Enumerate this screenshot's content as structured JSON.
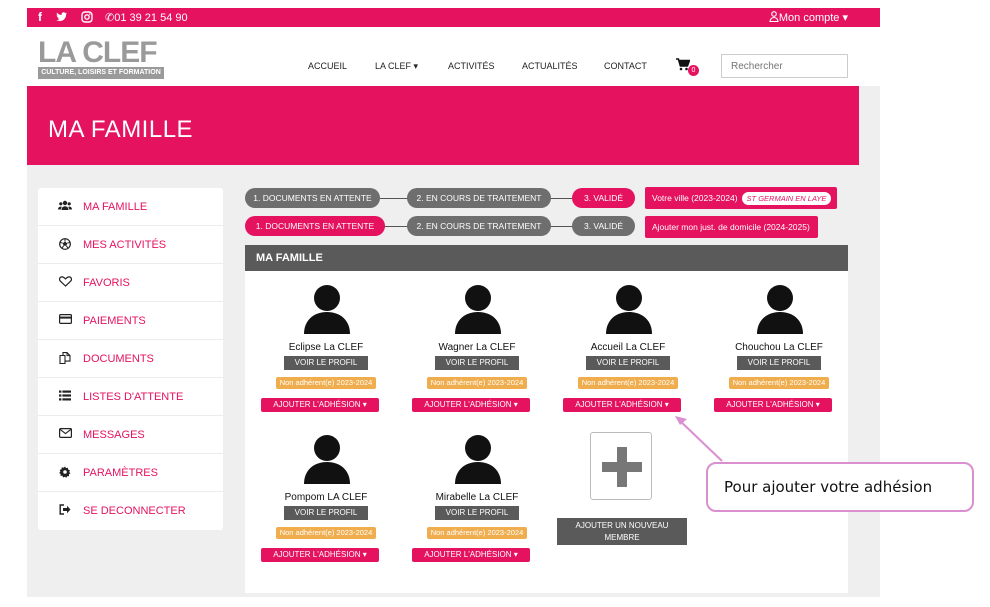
{
  "topbar": {
    "icons": [
      "facebook-icon",
      "twitter-icon",
      "instagram-icon",
      "phone-icon",
      "user-icon"
    ],
    "phone": "01 39 21 54 90",
    "account": "Mon compte ▾"
  },
  "logo": {
    "text": "LA CLEF",
    "tagline": "CULTURE, LOISIRS ET FORMATION"
  },
  "nav": {
    "items": [
      "ACCUEIL",
      "LA CLEF ▾",
      "ACTIVITÉS",
      "ACTUALITÉS",
      "CONTACT"
    ],
    "cart_count": "0",
    "search_placeholder": "Rechercher"
  },
  "banner": {
    "title": "MA FAMILLE"
  },
  "sidebar": {
    "items": [
      {
        "label": "MA FAMILLE",
        "icon": "users-icon"
      },
      {
        "label": "MES ACTIVITÉS",
        "icon": "soccer-ball-icon"
      },
      {
        "label": "FAVORIS",
        "icon": "heart-icon"
      },
      {
        "label": "PAIEMENTS",
        "icon": "credit-card-icon"
      },
      {
        "label": "DOCUMENTS",
        "icon": "documents-icon"
      },
      {
        "label": "LISTES D'ATTENTE",
        "icon": "list-icon"
      },
      {
        "label": "MESSAGES",
        "icon": "envelope-icon"
      },
      {
        "label": "PARAMÈTRES",
        "icon": "gear-icon"
      },
      {
        "label": "SE DECONNECTER",
        "icon": "sign-out-icon"
      }
    ]
  },
  "steps": {
    "labels": [
      "1. DOCUMENTS EN ATTENTE",
      "2. EN COURS DE TRAITEMENT",
      "3. VALIDÉ"
    ],
    "row1_status": "Votre ville (2023-2024)",
    "row1_city": "ST GERMAIN EN LAYE",
    "row2_status": "Ajouter mon just. de domicile (2024-2025)"
  },
  "panel": {
    "title": "MA FAMILLE"
  },
  "members": [
    {
      "name": "Eclipse La CLEF"
    },
    {
      "name": "Wagner La CLEF"
    },
    {
      "name": "Accueil La CLEF"
    },
    {
      "name": "Chouchou La CLEF"
    },
    {
      "name": "Pompom LA CLEF"
    },
    {
      "name": "Mirabelle La CLEF"
    }
  ],
  "member_labels": {
    "view_profile": "VOIR LE PROFIL",
    "status": "Non adhérent(e) 2023-2024",
    "add_membership": "AJOUTER L'ADHÉSION ▾"
  },
  "add_member": {
    "label_line1": "AJOUTER UN NOUVEAU",
    "label_line2": "MEMBRE"
  },
  "callout": {
    "text": "Pour ajouter votre adhésion"
  },
  "colors": {
    "brand": "#e5125f",
    "gray": "#5a5a5a",
    "status": "#f0ad4e",
    "callout_border": "#d98fd0"
  }
}
